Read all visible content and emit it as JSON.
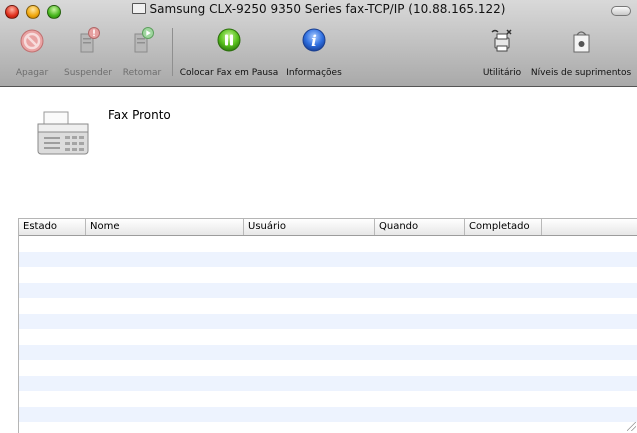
{
  "window": {
    "title": "Samsung CLX-9250 9350 Series fax-TCP/IP (10.88.165.122)"
  },
  "toolbar": {
    "delete_label": "Apagar",
    "hold_label": "Suspender",
    "resume_label": "Retomar",
    "pause_fax_label": "Colocar Fax em Pausa",
    "info_label": "Informações",
    "utility_label": "Utilitário",
    "supply_levels_label": "Níveis de suprimentos"
  },
  "status": {
    "text": "Fax Pronto"
  },
  "jobs_table": {
    "columns": [
      "Estado",
      "Nome",
      "Usuário",
      "Quando",
      "Completado"
    ],
    "rows": []
  },
  "colors": {
    "toolbar_top": "#d9d9d9",
    "toolbar_bottom": "#a9a9a9",
    "row_stripe": "#edf3fe",
    "pause_green": "#5ac21e",
    "info_blue": "#2f6fe0"
  },
  "icons": {
    "delete": "no-entry-icon",
    "hold": "hold-job-icon",
    "resume": "resume-job-icon",
    "pause": "pause-circle-icon",
    "info": "info-icon",
    "utility": "printer-utility-icon",
    "supplies": "supply-box-icon",
    "device": "fax-machine-icon"
  }
}
